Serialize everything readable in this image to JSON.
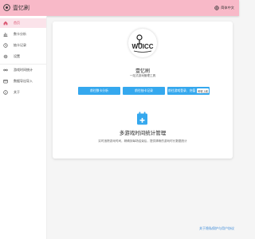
{
  "app": {
    "title": "壹忆刷"
  },
  "header": {
    "language": "简体中文"
  },
  "sidebar": {
    "items": [
      {
        "label": "首页",
        "icon": "home-icon"
      },
      {
        "label": "数卡分析",
        "icon": "chart-icon"
      },
      {
        "label": "抽卡记录",
        "icon": "history-icon"
      },
      {
        "label": "设置",
        "icon": "gear-icon"
      },
      {
        "label": "游戏时间统计",
        "icon": "clock-icon"
      },
      {
        "label": "数据导出导入",
        "icon": "database-icon"
      },
      {
        "label": "关于",
        "icon": "info-icon"
      }
    ]
  },
  "main": {
    "title": "壹忆刷",
    "subtitle": "一站式游戏管理工具",
    "buttons": [
      {
        "label": "前往数卡分析"
      },
      {
        "label": "前往抽卡记录"
      },
      {
        "label": "前往游戏登录、充值",
        "badge": "即将上线"
      }
    ],
    "feature": {
      "title": "多游戏时间统计管理",
      "description": "实时追踪游戏时间，精确到每场结束后，提供清晰的游戏时长数据统计"
    }
  },
  "footer": {
    "link": "关于隐私保护与用户协议"
  },
  "colors": {
    "header": "#f8b9c8",
    "accent": "#35a8ee",
    "active": "#d9536f"
  }
}
